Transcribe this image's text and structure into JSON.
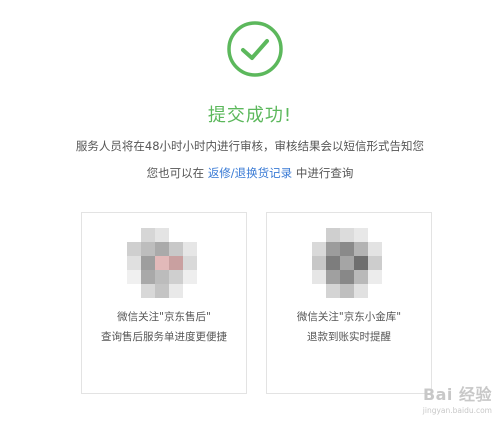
{
  "status": {
    "title": "提交成功!",
    "message_line1": "服务人员将在48小时小时内进行审核，审核结果会以短信形式告知您",
    "message_line2_prefix": "您也可以在 ",
    "message_line2_link": "返修/退换货记录",
    "message_line2_suffix": " 中进行查询",
    "accent_color": "#5cb85c",
    "link_color": "#3a7bd5"
  },
  "cards": [
    {
      "line1": "微信关注\"京东售后\"",
      "line2": "查询售后服务单进度更便捷",
      "qr_icon": "qr-code-icon"
    },
    {
      "line1": "微信关注\"京东小金库\"",
      "line2": "退款到账实时提醒",
      "qr_icon": "qr-code-icon"
    }
  ],
  "watermark": {
    "main": "Bai 经验",
    "sub": "jingyan.baidu.com"
  }
}
